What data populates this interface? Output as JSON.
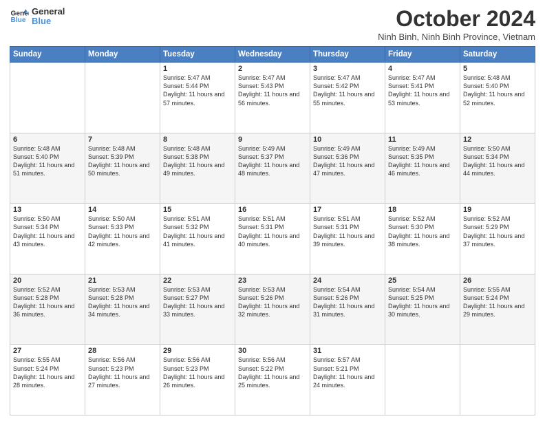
{
  "logo": {
    "line1": "General",
    "line2": "Blue"
  },
  "title": "October 2024",
  "location": "Ninh Binh, Ninh Binh Province, Vietnam",
  "days_of_week": [
    "Sunday",
    "Monday",
    "Tuesday",
    "Wednesday",
    "Thursday",
    "Friday",
    "Saturday"
  ],
  "weeks": [
    [
      {
        "day": "",
        "detail": ""
      },
      {
        "day": "",
        "detail": ""
      },
      {
        "day": "1",
        "detail": "Sunrise: 5:47 AM\nSunset: 5:44 PM\nDaylight: 11 hours and 57 minutes."
      },
      {
        "day": "2",
        "detail": "Sunrise: 5:47 AM\nSunset: 5:43 PM\nDaylight: 11 hours and 56 minutes."
      },
      {
        "day": "3",
        "detail": "Sunrise: 5:47 AM\nSunset: 5:42 PM\nDaylight: 11 hours and 55 minutes."
      },
      {
        "day": "4",
        "detail": "Sunrise: 5:47 AM\nSunset: 5:41 PM\nDaylight: 11 hours and 53 minutes."
      },
      {
        "day": "5",
        "detail": "Sunrise: 5:48 AM\nSunset: 5:40 PM\nDaylight: 11 hours and 52 minutes."
      }
    ],
    [
      {
        "day": "6",
        "detail": "Sunrise: 5:48 AM\nSunset: 5:40 PM\nDaylight: 11 hours and 51 minutes."
      },
      {
        "day": "7",
        "detail": "Sunrise: 5:48 AM\nSunset: 5:39 PM\nDaylight: 11 hours and 50 minutes."
      },
      {
        "day": "8",
        "detail": "Sunrise: 5:48 AM\nSunset: 5:38 PM\nDaylight: 11 hours and 49 minutes."
      },
      {
        "day": "9",
        "detail": "Sunrise: 5:49 AM\nSunset: 5:37 PM\nDaylight: 11 hours and 48 minutes."
      },
      {
        "day": "10",
        "detail": "Sunrise: 5:49 AM\nSunset: 5:36 PM\nDaylight: 11 hours and 47 minutes."
      },
      {
        "day": "11",
        "detail": "Sunrise: 5:49 AM\nSunset: 5:35 PM\nDaylight: 11 hours and 46 minutes."
      },
      {
        "day": "12",
        "detail": "Sunrise: 5:50 AM\nSunset: 5:34 PM\nDaylight: 11 hours and 44 minutes."
      }
    ],
    [
      {
        "day": "13",
        "detail": "Sunrise: 5:50 AM\nSunset: 5:34 PM\nDaylight: 11 hours and 43 minutes."
      },
      {
        "day": "14",
        "detail": "Sunrise: 5:50 AM\nSunset: 5:33 PM\nDaylight: 11 hours and 42 minutes."
      },
      {
        "day": "15",
        "detail": "Sunrise: 5:51 AM\nSunset: 5:32 PM\nDaylight: 11 hours and 41 minutes."
      },
      {
        "day": "16",
        "detail": "Sunrise: 5:51 AM\nSunset: 5:31 PM\nDaylight: 11 hours and 40 minutes."
      },
      {
        "day": "17",
        "detail": "Sunrise: 5:51 AM\nSunset: 5:31 PM\nDaylight: 11 hours and 39 minutes."
      },
      {
        "day": "18",
        "detail": "Sunrise: 5:52 AM\nSunset: 5:30 PM\nDaylight: 11 hours and 38 minutes."
      },
      {
        "day": "19",
        "detail": "Sunrise: 5:52 AM\nSunset: 5:29 PM\nDaylight: 11 hours and 37 minutes."
      }
    ],
    [
      {
        "day": "20",
        "detail": "Sunrise: 5:52 AM\nSunset: 5:28 PM\nDaylight: 11 hours and 36 minutes."
      },
      {
        "day": "21",
        "detail": "Sunrise: 5:53 AM\nSunset: 5:28 PM\nDaylight: 11 hours and 34 minutes."
      },
      {
        "day": "22",
        "detail": "Sunrise: 5:53 AM\nSunset: 5:27 PM\nDaylight: 11 hours and 33 minutes."
      },
      {
        "day": "23",
        "detail": "Sunrise: 5:53 AM\nSunset: 5:26 PM\nDaylight: 11 hours and 32 minutes."
      },
      {
        "day": "24",
        "detail": "Sunrise: 5:54 AM\nSunset: 5:26 PM\nDaylight: 11 hours and 31 minutes."
      },
      {
        "day": "25",
        "detail": "Sunrise: 5:54 AM\nSunset: 5:25 PM\nDaylight: 11 hours and 30 minutes."
      },
      {
        "day": "26",
        "detail": "Sunrise: 5:55 AM\nSunset: 5:24 PM\nDaylight: 11 hours and 29 minutes."
      }
    ],
    [
      {
        "day": "27",
        "detail": "Sunrise: 5:55 AM\nSunset: 5:24 PM\nDaylight: 11 hours and 28 minutes."
      },
      {
        "day": "28",
        "detail": "Sunrise: 5:56 AM\nSunset: 5:23 PM\nDaylight: 11 hours and 27 minutes."
      },
      {
        "day": "29",
        "detail": "Sunrise: 5:56 AM\nSunset: 5:23 PM\nDaylight: 11 hours and 26 minutes."
      },
      {
        "day": "30",
        "detail": "Sunrise: 5:56 AM\nSunset: 5:22 PM\nDaylight: 11 hours and 25 minutes."
      },
      {
        "day": "31",
        "detail": "Sunrise: 5:57 AM\nSunset: 5:21 PM\nDaylight: 11 hours and 24 minutes."
      },
      {
        "day": "",
        "detail": ""
      },
      {
        "day": "",
        "detail": ""
      }
    ]
  ]
}
